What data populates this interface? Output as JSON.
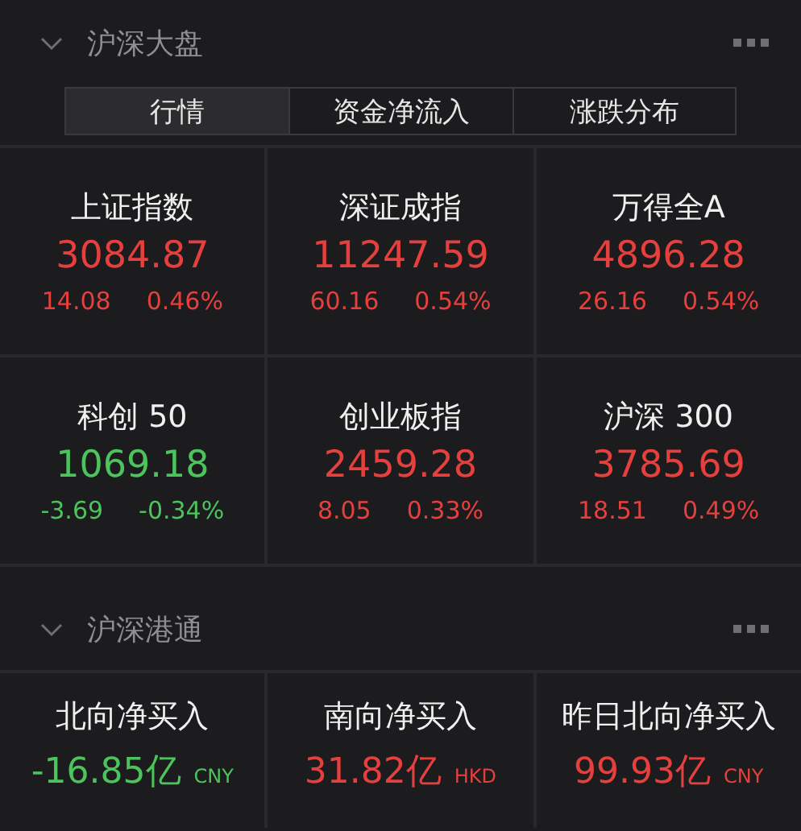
{
  "sections": [
    {
      "title": "沪深大盘",
      "expanded": true,
      "tabs": [
        {
          "label": "行情",
          "selected": true
        },
        {
          "label": "资金净流入",
          "selected": false
        },
        {
          "label": "涨跌分布",
          "selected": false
        }
      ],
      "indices": [
        {
          "name": "上证指数",
          "price": "3084.87",
          "change": "14.08",
          "percent": "0.46%",
          "kind": "up"
        },
        {
          "name": "深证成指",
          "price": "11247.59",
          "change": "60.16",
          "percent": "0.54%",
          "kind": "up"
        },
        {
          "name": "万得全A",
          "price": "4896.28",
          "change": "26.16",
          "percent": "0.54%",
          "kind": "up"
        },
        {
          "name": "科创 50",
          "price": "1069.18",
          "change": "-3.69",
          "percent": "-0.34%",
          "kind": "down"
        },
        {
          "name": "创业板指",
          "price": "2459.28",
          "change": "8.05",
          "percent": "0.33%",
          "kind": "up"
        },
        {
          "name": "沪深 300",
          "price": "3785.69",
          "change": "18.51",
          "percent": "0.49%",
          "kind": "up"
        }
      ]
    },
    {
      "title": "沪深港通",
      "expanded": true,
      "flows": [
        {
          "name": "北向净买入",
          "amount": "-16.85亿",
          "currency": "CNY",
          "kind": "down"
        },
        {
          "name": "南向净买入",
          "amount": "31.82亿",
          "currency": "HKD",
          "kind": "up"
        },
        {
          "name": "昨日北向净买入",
          "amount": "99.93亿",
          "currency": "CNY",
          "kind": "up"
        }
      ]
    }
  ]
}
